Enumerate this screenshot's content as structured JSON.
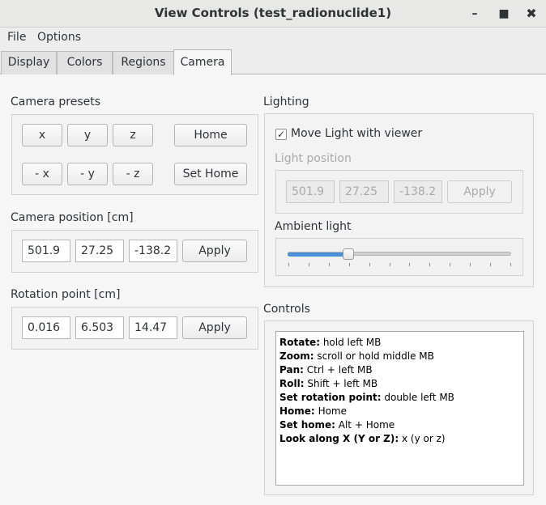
{
  "window": {
    "title": "View Controls (test_radionuclide1)",
    "buttons": {
      "minimize": "–",
      "maximize": "■",
      "close": "✖"
    }
  },
  "menubar": {
    "file": "File",
    "options": "Options"
  },
  "tabs": [
    {
      "label": "Display",
      "active": false
    },
    {
      "label": "Colors",
      "active": false
    },
    {
      "label": "Regions",
      "active": false
    },
    {
      "label": "Camera",
      "active": true
    }
  ],
  "camera_presets": {
    "label": "Camera presets",
    "buttons": [
      "x",
      "y",
      "z",
      "Home",
      "- x",
      "- y",
      "- z",
      "Set Home"
    ]
  },
  "camera_position": {
    "label": "Camera position [cm]",
    "values": [
      "501.9",
      "27.25",
      "-138.2"
    ],
    "apply_label": "Apply"
  },
  "rotation_point": {
    "label": "Rotation point [cm]",
    "values": [
      "0.016",
      "6.503",
      "14.47"
    ],
    "apply_label": "Apply"
  },
  "lighting": {
    "label": "Lighting",
    "move_light_label": "Move Light with viewer",
    "move_light_checked": true,
    "light_position_label": "Light position",
    "light_position_values": [
      "501.9",
      "27.25",
      "-138.2"
    ],
    "apply_label": "Apply",
    "ambient_label": "Ambient light",
    "ambient_level": 0.27
  },
  "controls": {
    "label": "Controls",
    "lines": [
      {
        "key": "Rotate:",
        "value": "hold left MB"
      },
      {
        "key": "Zoom:",
        "value": "scroll or hold middle MB"
      },
      {
        "key": "Pan:",
        "value": "Ctrl + left MB"
      },
      {
        "key": "Roll:",
        "value": "Shift + left MB"
      },
      {
        "key": "Set rotation point:",
        "value": "double left MB"
      },
      {
        "key": "Home:",
        "value": "Home"
      },
      {
        "key": "Set home:",
        "value": "Alt + Home"
      },
      {
        "key": "Look along X (Y or Z):",
        "value": "x (y or z)"
      }
    ]
  },
  "colors": {
    "accent": "#4a90d9",
    "background": "#f6f6f6"
  }
}
